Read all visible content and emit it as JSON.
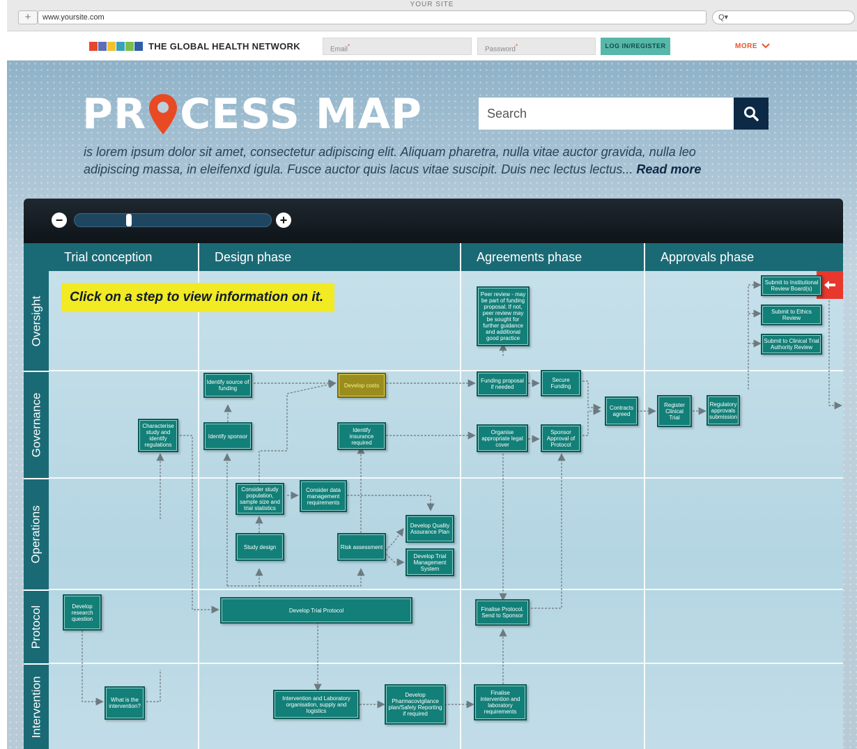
{
  "browser": {
    "window_title": "YOUR SITE",
    "new_tab_glyph": "+",
    "url": "www.yoursite.com",
    "search_glyph": "Q▾"
  },
  "sitenav": {
    "brand": "THE GLOBAL HEALTH NETWORK",
    "flag_colors": [
      "#e6472b",
      "#5f6db4",
      "#f2c12e",
      "#3aa1b7",
      "#7abf4b",
      "#2f5ea8"
    ],
    "email_placeholder": "Email",
    "password_placeholder": "Password",
    "required_mark": "*",
    "login_label": "LOG IN/REGISTER",
    "more_label": "MORE",
    "more_icon": "chevron-down-icon"
  },
  "hero": {
    "title_start": "PR",
    "title_end": "CESS MAP",
    "search_placeholder": "Search",
    "search_icon": "search-icon",
    "intro_text": "is lorem ipsum dolor sit amet, consectetur adipiscing elit. Aliquam pharetra, nulla vitae auctor gravida, nulla leo adipiscing massa, in eleifenxd igula. Fusce auctor quis lacus vitae suscipit. Duis nec lectus lectus...",
    "read_more": "Read more"
  },
  "map": {
    "zoom_out_glyph": "−",
    "zoom_in_glyph": "+",
    "zoom_level": 0.27,
    "phases": [
      "Trial conception",
      "Design phase",
      "Agreements phase",
      "Approvals phase"
    ],
    "lanes": [
      "Oversight",
      "Governance",
      "Operations",
      "Protocol",
      "Intervention"
    ],
    "tip": "Click on a step to view information on it.",
    "colors": {
      "box": "#127f78",
      "highlight": "#9a8d1d",
      "header": "#1a6a75",
      "tip": "#f2ea23",
      "tab": "#e8372c"
    },
    "steps": {
      "peer_review": "Peer review - may be part of funding proposal. If not, peer review may be sought for further guidance and additional good practice",
      "submit_irb": "Submit to Institutional Review Board(s)",
      "submit_ethics": "Submit to Ethics Review",
      "submit_cta": "Submit to Clinical Trial Authority Review",
      "identify_funding": "Identify source of funding",
      "develop_costs": "Develop costs",
      "funding_proposal": "Funding proposal if needed",
      "secure_funding": "Secure Funding",
      "contracts_agreed": "Contracts agreed",
      "register_trial": "Register Clinical Trial",
      "regulatory_submission": "Regulatory approvals submission",
      "characterise_study": "Characterise study and identify regulations",
      "identify_sponsor": "Identify sponsor",
      "identify_insurance": "Identify insurance required",
      "organise_legal": "Organise appropriate legal cover",
      "sponsor_approval": "Sponsor Approval of Protocol",
      "consider_population": "Consider study population, sample size and trial statistics",
      "consider_data": "Consider data management requirements",
      "develop_qa": "Develop Quality Assurance Plan",
      "study_design": "Study design",
      "risk_assessment": "Risk assessment",
      "develop_tms": "Develop Trial Management System",
      "develop_question": "Develop research question",
      "develop_protocol": "Develop Trial Protocol",
      "finalise_protocol": "Finalise Protocol. Send to Sponsor",
      "what_intervention": "What is the intervention?",
      "intervention_lab": "Intervention and Laboratory organisation, supply and logistics",
      "develop_pv": "Develop Pharmacovigilance plan/Safety Reporting if required",
      "finalise_intervention": "Finalise intervention and laboratory requirements"
    }
  }
}
